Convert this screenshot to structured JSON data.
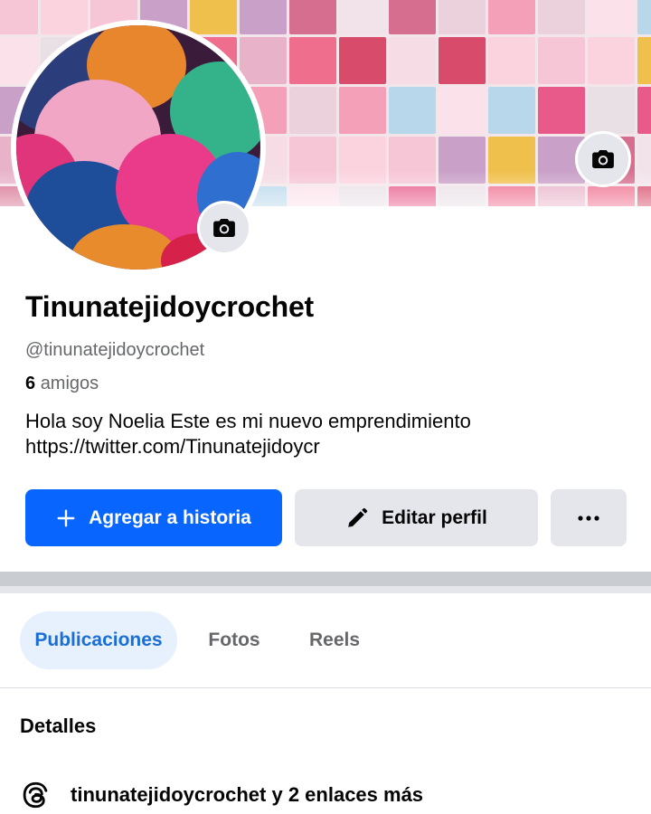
{
  "profile": {
    "name": "Tinunatejidoycrochet",
    "handle": "@tinunatejidoycrochet",
    "friends_count": "6",
    "friends_label": "amigos",
    "bio_line1": "Hola soy Noelia  Este es mi nuevo emprendimiento",
    "bio_line2": "https://twitter.com/Tinunatejidoycr"
  },
  "actions": {
    "add_story": "Agregar a historia",
    "edit_profile": "Editar perfil"
  },
  "tabs": [
    {
      "label": "Publicaciones",
      "active": true
    },
    {
      "label": "Fotos",
      "active": false
    },
    {
      "label": "Reels",
      "active": false
    }
  ],
  "details": {
    "title": "Detalles",
    "link_text": "tinunatejidoycrochet y 2 enlaces más"
  },
  "colors": {
    "accent": "#0866ff",
    "tab_active_bg": "#e7f1fd",
    "tab_active_text": "#1a6ed8",
    "secondary_btn": "#e4e6eb",
    "muted_text": "#65676b"
  },
  "icons": {
    "cover_camera": "camera-icon",
    "avatar_camera": "camera-icon",
    "add_story": "plus-icon",
    "edit_profile": "pencil-icon",
    "more": "more-dots-icon",
    "details_link": "threads-icon"
  }
}
